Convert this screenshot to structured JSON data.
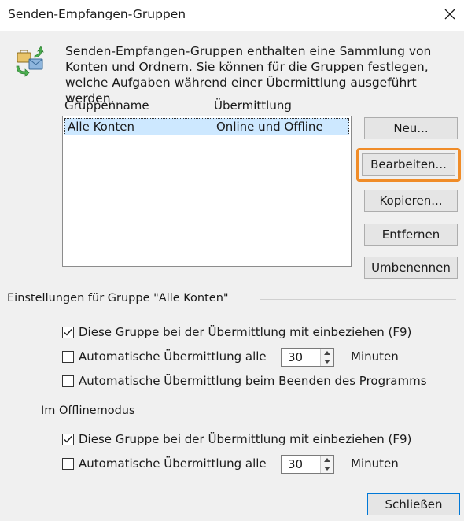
{
  "window": {
    "title": "Senden-Empfangen-Gruppen",
    "close_symbol": "×"
  },
  "intro": {
    "icon": "send-receive-groups-icon",
    "text": "Senden-Empfangen-Gruppen enthalten eine Sammlung von Konten und Ordnern. Sie können für die Gruppen festlegen, welche Aufgaben während einer Übermittlung ausgeführt werden."
  },
  "groups_list": {
    "columns": [
      "Gruppenname",
      "Übermittlung"
    ],
    "rows": [
      {
        "name": "Alle Konten",
        "transfer": "Online und Offline",
        "selected": true
      }
    ]
  },
  "buttons": {
    "new": "Neu...",
    "edit": "Bearbeiten...",
    "copy": "Kopieren...",
    "remove": "Entfernen",
    "rename": "Umbenennen",
    "close": "Schließen"
  },
  "highlight_color": "#f08c28",
  "settings": {
    "group_label": "Einstellungen für Gruppe \"Alle Konten\"",
    "online": {
      "include": {
        "label": "Diese Gruppe bei der Übermittlung mit einbeziehen (F9)",
        "checked": true
      },
      "auto": {
        "label": "Automatische Übermittlung alle",
        "checked": false,
        "value": "30",
        "unit": "Minuten"
      },
      "on_exit": {
        "label": "Automatische Übermittlung beim Beenden des Programms",
        "checked": false
      }
    },
    "offline_label": "Im Offlinemodus",
    "offline": {
      "include": {
        "label": "Diese Gruppe bei der Übermittlung mit einbeziehen (F9)",
        "checked": true
      },
      "auto": {
        "label": "Automatische Übermittlung alle",
        "checked": false,
        "value": "30",
        "unit": "Minuten"
      }
    }
  }
}
